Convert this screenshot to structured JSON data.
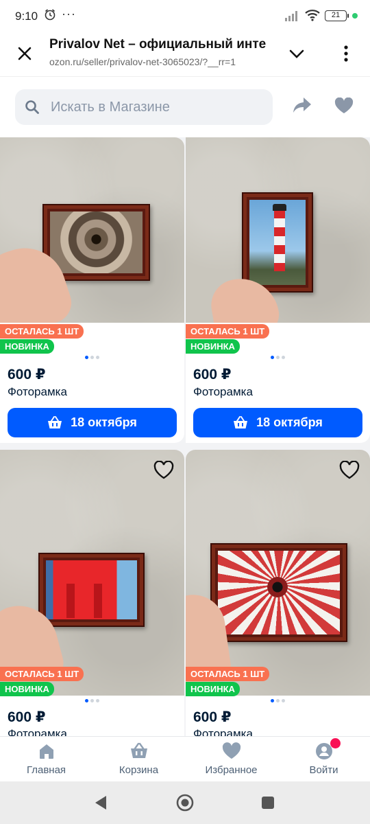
{
  "status_bar": {
    "time": "9:10",
    "battery": "21"
  },
  "browser": {
    "title": "Privalov Net – официальный инте",
    "url": "ozon.ru/seller/privalov-net-3065023/?__rr=1"
  },
  "search": {
    "placeholder": "Искать в Магазине"
  },
  "products": [
    {
      "badge_stock": "ОСТАЛАСЬ 1 ШТ",
      "badge_new": "НОВИНКА",
      "price": "600 ₽",
      "name": "Фоторамка",
      "delivery": "18 октября"
    },
    {
      "badge_stock": "ОСТАЛАСЬ 1 ШТ",
      "badge_new": "НОВИНКА",
      "price": "600 ₽",
      "name": "Фоторамка",
      "delivery": "18 октября"
    },
    {
      "badge_stock": "ОСТАЛАСЬ 1 ШТ",
      "badge_new": "НОВИНКА",
      "price": "600 ₽",
      "name": "Фоторамка"
    },
    {
      "badge_stock": "ОСТАЛАСЬ 1 ШТ",
      "badge_new": "НОВИНКА",
      "price": "600 ₽",
      "name": "Фоторамка"
    }
  ],
  "bottom_nav": [
    {
      "label": "Главная",
      "icon": "home-icon"
    },
    {
      "label": "Корзина",
      "icon": "cart-icon"
    },
    {
      "label": "Избранное",
      "icon": "heart-icon"
    },
    {
      "label": "Войти",
      "icon": "profile-icon"
    }
  ],
  "colors": {
    "accent": "#005bff",
    "badge_stock": "#f97150",
    "badge_new": "#10c44c",
    "notification": "#f91155"
  }
}
